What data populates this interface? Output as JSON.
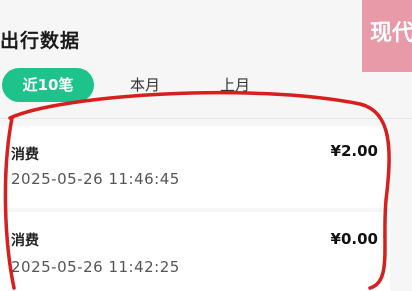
{
  "header": {
    "title": "出行数据",
    "badge_text": "现代"
  },
  "tabs": [
    {
      "label": "近10笔",
      "active": true
    },
    {
      "label": "本月",
      "active": false
    },
    {
      "label": "上月",
      "active": false
    }
  ],
  "records": [
    {
      "type": "消费",
      "time": "2025-05-26 11:46:45",
      "amount": "¥2.00"
    },
    {
      "type": "消费",
      "time": "2025-05-26 11:42:25",
      "amount": "¥0.00"
    }
  ],
  "colors": {
    "accent": "#1ec28b",
    "badge": "#e89aa8",
    "annotation": "#d81e1e"
  }
}
